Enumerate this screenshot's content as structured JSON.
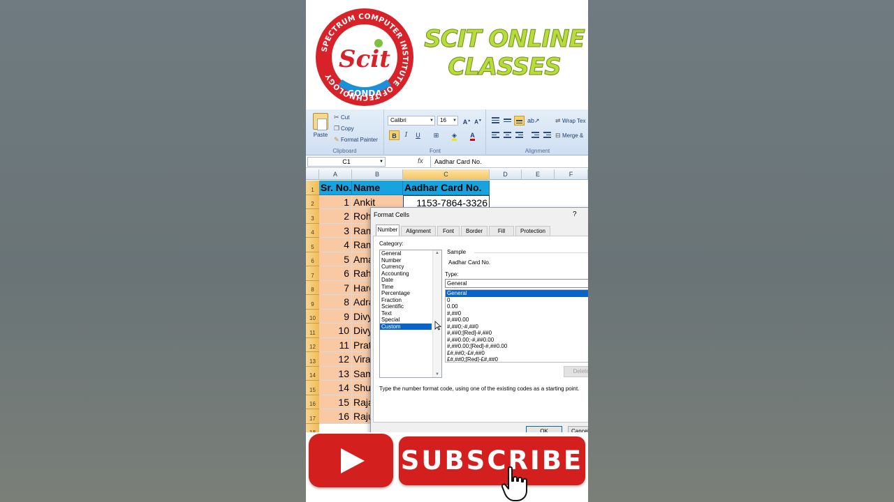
{
  "logo": {
    "ring_text": "SPECTRUM COMPUTER INSTITUTE OF TECHNOLOGY",
    "mark": "Scit",
    "city": "GONDA"
  },
  "brand": {
    "line1": "SCIT ONLINE",
    "line2": "CLASSES"
  },
  "ribbon": {
    "clipboard": {
      "paste_label": "Paste",
      "cut_label": "Cut",
      "copy_label": "Copy",
      "format_painter_label": "Format Painter",
      "group_label": "Clipboard"
    },
    "font": {
      "font_name": "Calibri",
      "font_size": "16",
      "bold": "B",
      "italic": "I",
      "underline": "U",
      "group_label": "Font"
    },
    "alignment": {
      "wrap_text_label": "Wrap Tex",
      "merge_label": "Merge &",
      "group_label": "Alignment"
    }
  },
  "formula_bar": {
    "name_box": "C1",
    "fx": "fx",
    "content": "Aadhar Card No."
  },
  "sheet": {
    "columns": [
      "A",
      "B",
      "C",
      "D",
      "E",
      "F"
    ],
    "row_numbers": [
      "1",
      "2",
      "3",
      "4",
      "5",
      "6",
      "7",
      "8",
      "9",
      "10",
      "11",
      "12",
      "13",
      "14",
      "15",
      "16",
      "17",
      "18"
    ],
    "header": {
      "a": "Sr. No.",
      "b": "Name",
      "c": "Aadhar Card No."
    },
    "rows": [
      {
        "sr": "1",
        "name": "Ankit",
        "card": "1153-7864-3326"
      },
      {
        "sr": "2",
        "name": "Roh"
      },
      {
        "sr": "3",
        "name": "Ram"
      },
      {
        "sr": "4",
        "name": "Ram"
      },
      {
        "sr": "5",
        "name": "Ama"
      },
      {
        "sr": "6",
        "name": "Rah"
      },
      {
        "sr": "7",
        "name": "Hard"
      },
      {
        "sr": "8",
        "name": "Adra"
      },
      {
        "sr": "9",
        "name": "Divy"
      },
      {
        "sr": "10",
        "name": "Divy"
      },
      {
        "sr": "11",
        "name": "Prat"
      },
      {
        "sr": "12",
        "name": "Vira"
      },
      {
        "sr": "13",
        "name": "Sam"
      },
      {
        "sr": "14",
        "name": "Shu"
      },
      {
        "sr": "15",
        "name": "Raja"
      },
      {
        "sr": "16",
        "name": "Raju"
      }
    ]
  },
  "dialog": {
    "title": "Format Cells",
    "help": "?",
    "tabs": [
      "Number",
      "Alignment",
      "Font",
      "Border",
      "Fill",
      "Protection"
    ],
    "category_label": "Category:",
    "categories": [
      "General",
      "Number",
      "Currency",
      "Accounting",
      "Date",
      "Time",
      "Percentage",
      "Fraction",
      "Scientific",
      "Text",
      "Special",
      "Custom"
    ],
    "sample_label": "Sample",
    "sample_value": "Aadhar Card No.",
    "type_label": "Type:",
    "type_value": "General",
    "types": [
      "General",
      "0",
      "0.00",
      "#,##0",
      "#,##0.00",
      "#,##0;-#,##0",
      "#,##0;[Red]-#,##0",
      "#,##0.00;-#,##0.00",
      "#,##0.00;[Red]-#,##0.00",
      "£#,##0;-£#,##0",
      "£#,##0;[Red]-£#,##0"
    ],
    "delete_label": "Delete",
    "hint": "Type the number format code, using one of the existing codes as a starting point.",
    "ok_label": "OK",
    "cancel_label": "Cancel"
  },
  "footer": {
    "subscribe_label": "SUBSCRIBE"
  },
  "colors": {
    "header_fill": "#17a3df",
    "data_fill": "#f9c9a3",
    "brand_green": "#b7dd3c",
    "youtube_red": "#d41f1f",
    "selection_blue": "#0a64c8"
  }
}
